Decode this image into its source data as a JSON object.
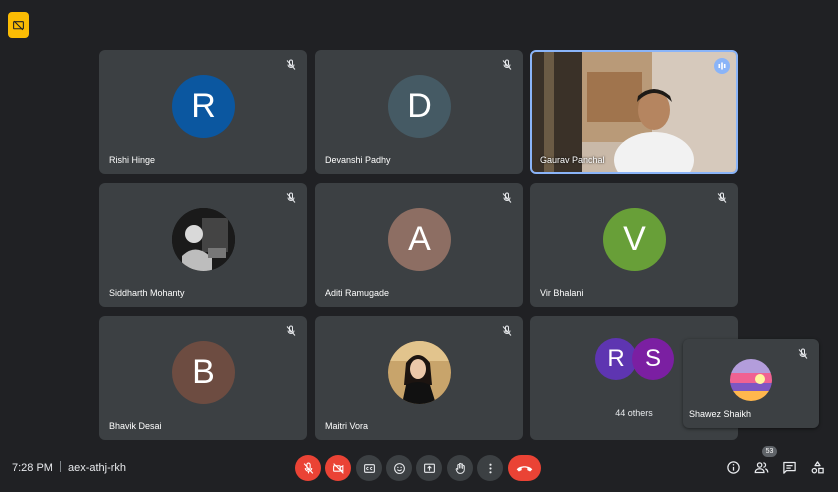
{
  "meeting": {
    "time": "7:28 PM",
    "code": "aex-athj-rkh"
  },
  "participants_count": "53",
  "tiles": [
    {
      "name": "Rishi Hinge",
      "initial": "R",
      "color": "#0b57a0"
    },
    {
      "name": "Devanshi Padhy",
      "initial": "D",
      "color": "#455a64"
    },
    {
      "name": "Gaurav Panchal"
    },
    {
      "name": "Siddharth Mohanty"
    },
    {
      "name": "Aditi Ramugade",
      "initial": "A",
      "color": "#8d6e63"
    },
    {
      "name": "Vir Bhalani",
      "initial": "V",
      "color": "#689f38"
    },
    {
      "name": "Bhavik Desai",
      "initial": "B",
      "color": "#6d4c41"
    },
    {
      "name": "Maitri Vora"
    }
  ],
  "others": {
    "label": "44 others",
    "initials": [
      "R",
      "S"
    ],
    "colors": [
      "#5e35b1",
      "#7b1fa2"
    ]
  },
  "self": {
    "name": "Shawez Shaikh"
  },
  "controls": [
    "mic-off",
    "camera-off",
    "captions",
    "emoji",
    "present",
    "raise-hand",
    "more-options",
    "leave-call"
  ],
  "right_controls": [
    "meeting-details",
    "people",
    "chat",
    "activities"
  ]
}
